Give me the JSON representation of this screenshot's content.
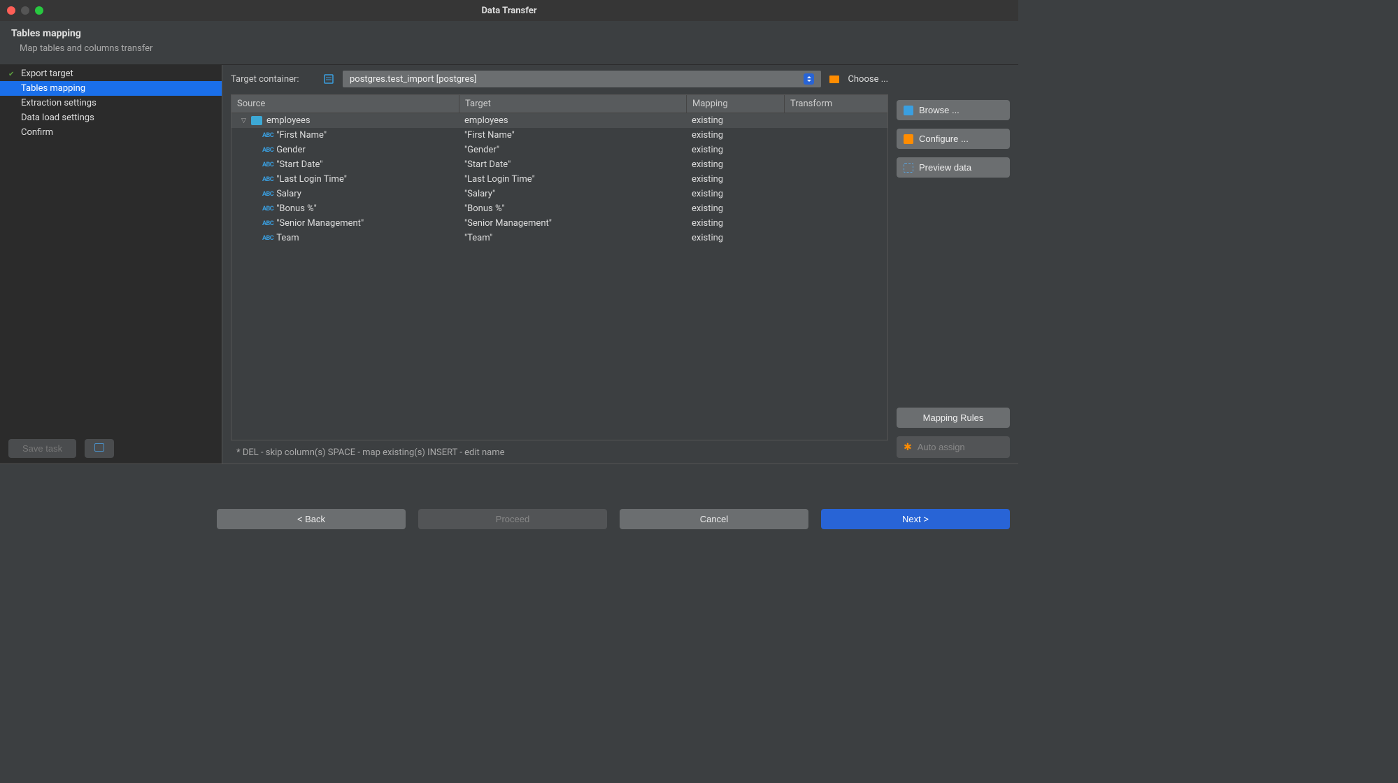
{
  "window": {
    "title": "Data Transfer"
  },
  "subhead": {
    "title": "Tables mapping",
    "desc": "Map tables and columns transfer"
  },
  "nav": {
    "items": [
      {
        "label": "Export target",
        "check": true,
        "active": false
      },
      {
        "label": "Tables mapping",
        "check": false,
        "active": true
      },
      {
        "label": "Extraction settings",
        "check": false,
        "active": false
      },
      {
        "label": "Data load settings",
        "check": false,
        "active": false
      },
      {
        "label": "Confirm",
        "check": false,
        "active": false
      }
    ],
    "save_task": "Save task"
  },
  "target": {
    "label": "Target container:",
    "value": "postgres.test_import  [postgres]",
    "choose": "Choose ..."
  },
  "columns": {
    "source": "Source",
    "target": "Target",
    "mapping": "Mapping",
    "transform": "Transform"
  },
  "rows": [
    {
      "type": "table",
      "source": "employees",
      "target": "employees",
      "mapping": "existing",
      "selected": true
    },
    {
      "type": "col",
      "source": "\"First Name\"",
      "target": "\"First Name\"",
      "mapping": "existing"
    },
    {
      "type": "col",
      "source": "Gender",
      "target": "\"Gender\"",
      "mapping": "existing"
    },
    {
      "type": "col",
      "source": "\"Start Date\"",
      "target": "\"Start Date\"",
      "mapping": "existing"
    },
    {
      "type": "col",
      "source": "\"Last Login Time\"",
      "target": "\"Last Login Time\"",
      "mapping": "existing"
    },
    {
      "type": "col",
      "source": "Salary",
      "target": "\"Salary\"",
      "mapping": "existing"
    },
    {
      "type": "col",
      "source": "\"Bonus %\"",
      "target": "\"Bonus %\"",
      "mapping": "existing"
    },
    {
      "type": "col",
      "source": "\"Senior Management\"",
      "target": "\"Senior Management\"",
      "mapping": "existing"
    },
    {
      "type": "col",
      "source": "Team",
      "target": "\"Team\"",
      "mapping": "existing"
    }
  ],
  "hint": "* DEL - skip column(s)  SPACE - map existing(s)  INSERT - edit name",
  "right": {
    "browse": "Browse ...",
    "configure": "Configure ...",
    "preview": "Preview data",
    "rules": "Mapping Rules",
    "auto": "Auto assign"
  },
  "footer": {
    "back": "< Back",
    "proceed": "Proceed",
    "cancel": "Cancel",
    "next": "Next >"
  }
}
